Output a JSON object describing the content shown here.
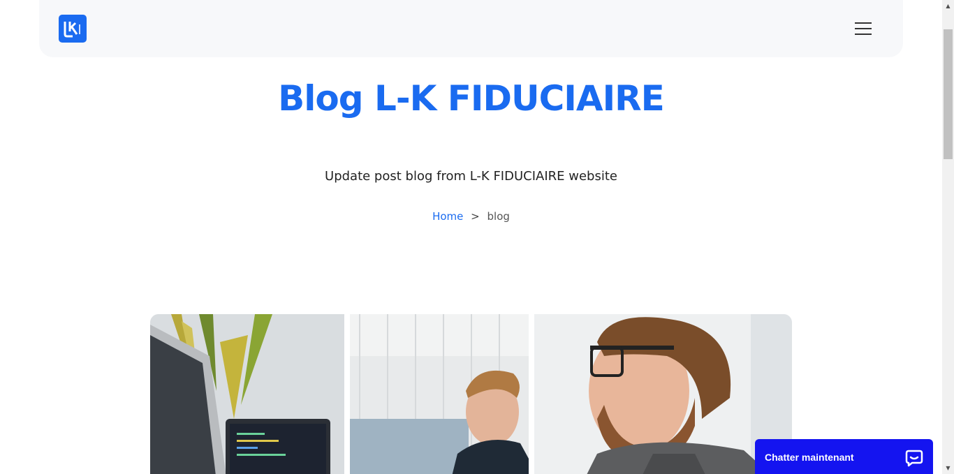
{
  "brand": {
    "logo_text": "LK",
    "logo_color": "#1a6bf0"
  },
  "header": {
    "menu_icon": "hamburger-menu-icon"
  },
  "hero": {
    "title": "Blog L-K FIDUCIAIRE",
    "subtitle": "Update post blog from L-K FIDUCIAIRE website",
    "title_color": "#1a6bf0"
  },
  "breadcrumb": {
    "home": "Home",
    "separator": ">",
    "current": "blog"
  },
  "featured_image": {
    "alt": "photo"
  },
  "chat": {
    "label": "Chatter maintenant",
    "icon": "chat-bubble-icon",
    "color": "#1414f0"
  }
}
